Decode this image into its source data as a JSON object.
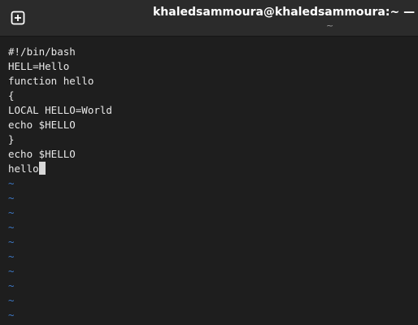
{
  "window": {
    "title": "khaledsammoura@khaledsammoura:~ — /usr/lib",
    "subtitle": "~"
  },
  "editor": {
    "lines": [
      "#!/bin/bash",
      "HELL=Hello",
      "function hello",
      "{",
      "LOCAL HELLO=World",
      "echo $HELLO",
      "}",
      "echo $HELLO",
      "hello"
    ],
    "empty_marker": "~"
  },
  "icons": {
    "new_tab": "new-tab-plus-icon"
  }
}
